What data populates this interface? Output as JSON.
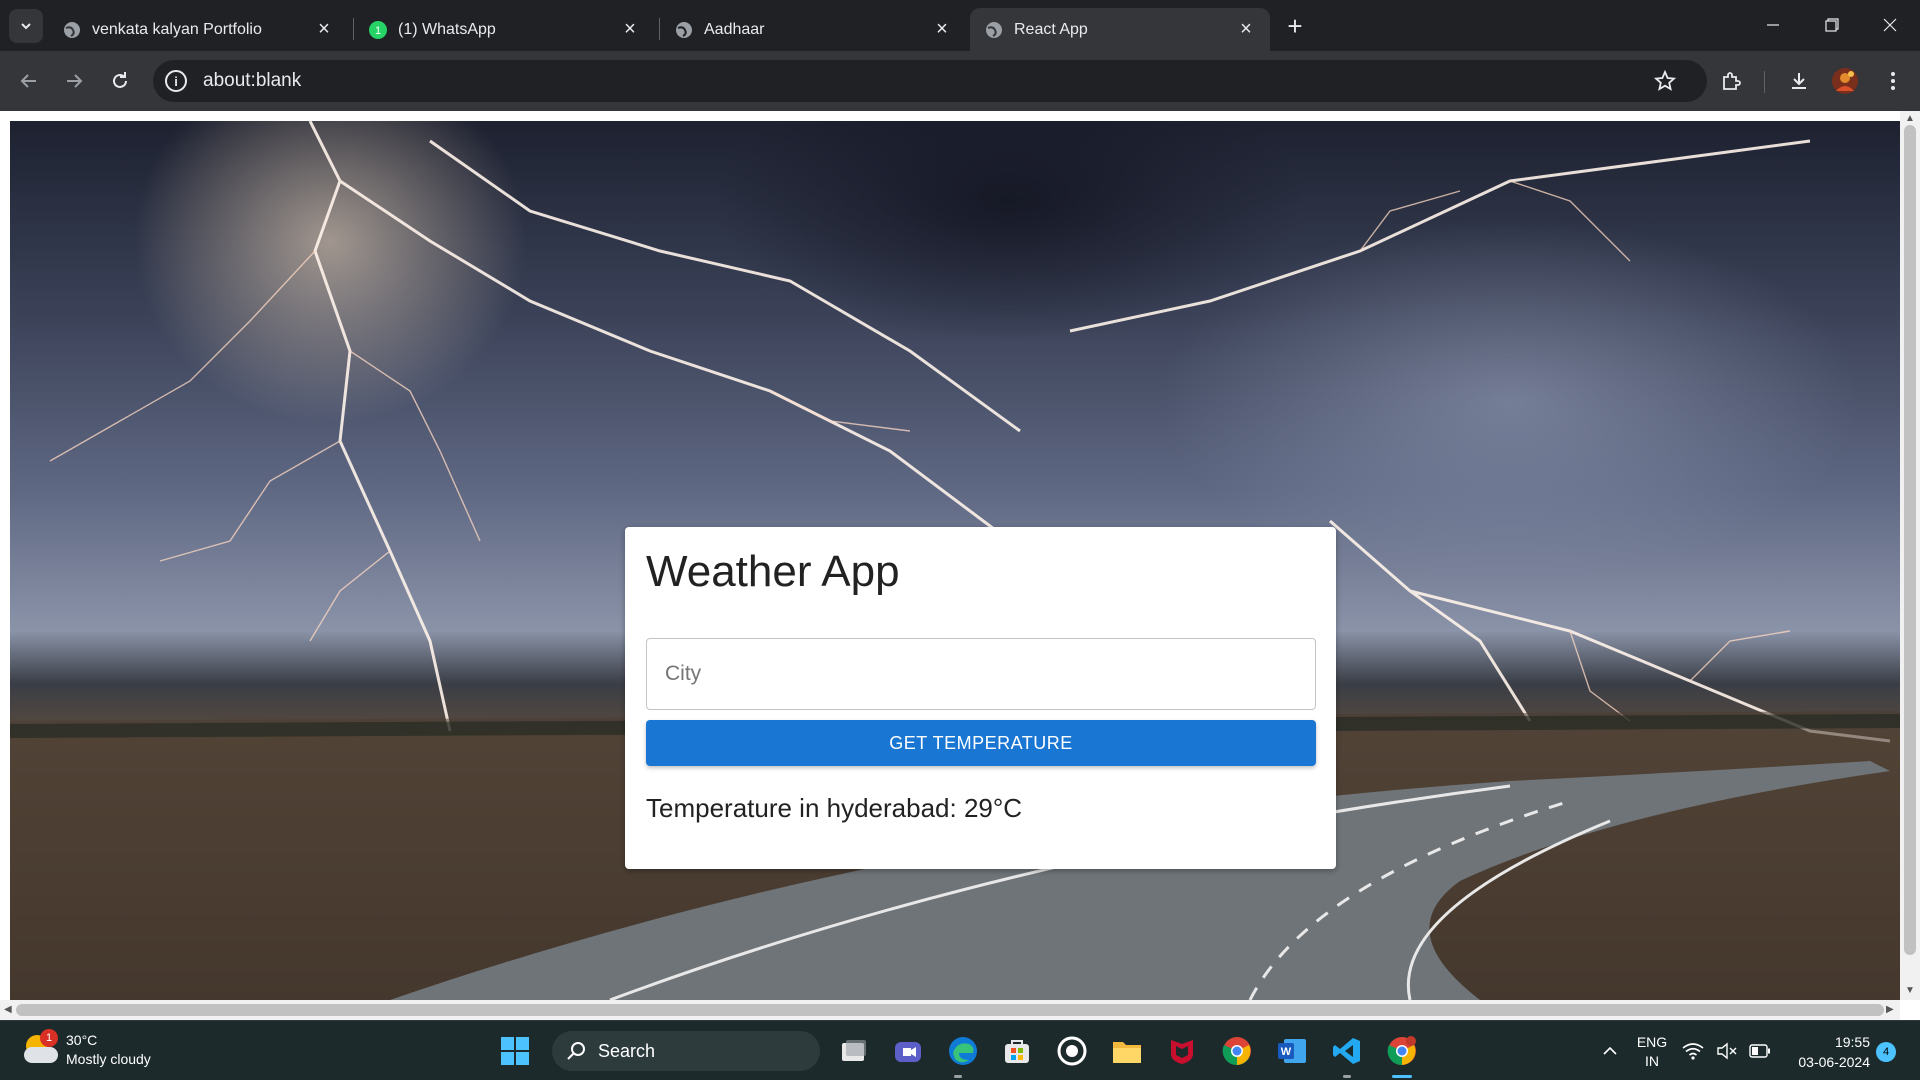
{
  "browser": {
    "tabs": [
      {
        "title": "venkata kalyan Portfolio",
        "active": false
      },
      {
        "title": "(1) WhatsApp",
        "active": false
      },
      {
        "title": "Aadhaar",
        "active": false
      },
      {
        "title": "React App",
        "active": true
      }
    ],
    "whatsapp_badge": "1",
    "url": "about:blank"
  },
  "app": {
    "title": "Weather App",
    "city_placeholder": "City",
    "city_value": "",
    "button_label": "GET TEMPERATURE",
    "result_text": "Temperature in hyderabad: 29°C",
    "accent_color": "#1976d2"
  },
  "taskbar": {
    "weather_temp": "30°C",
    "weather_desc": "Mostly cloudy",
    "weather_badge": "1",
    "search_label": "Search",
    "lang_top": "ENG",
    "lang_bottom": "IN",
    "time": "19:55",
    "date": "03-06-2024",
    "notification_count": "4",
    "pinned_icons": [
      "task-view-icon",
      "meet-icon",
      "edge-icon",
      "store-icon",
      "app-icon",
      "file-explorer-icon",
      "mcafee-icon",
      "chrome-icon",
      "word-icon",
      "vscode-icon",
      "chrome-active-icon"
    ]
  }
}
